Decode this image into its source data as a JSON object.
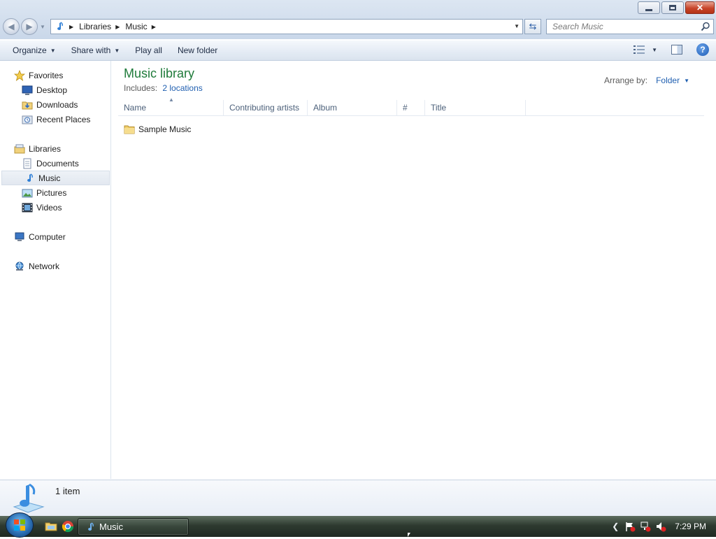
{
  "window": {
    "caption_buttons": {
      "minimize_icon": "minimize-icon",
      "maximize_icon": "restore-icon",
      "close_icon": "close-icon"
    }
  },
  "address": {
    "breadcrumbs": [
      "Libraries",
      "Music"
    ],
    "search_placeholder": "Search Music"
  },
  "toolbar": {
    "organize": "Organize",
    "share_with": "Share with",
    "play_all": "Play all",
    "new_folder": "New folder"
  },
  "navpane": {
    "favorites": {
      "label": "Favorites",
      "items": [
        "Desktop",
        "Downloads",
        "Recent Places"
      ]
    },
    "libraries": {
      "label": "Libraries",
      "items": [
        "Documents",
        "Music",
        "Pictures",
        "Videos"
      ]
    },
    "computer": "Computer",
    "network": "Network",
    "selected": "Music"
  },
  "content": {
    "title": "Music library",
    "includes_label": "Includes:",
    "includes_link": "2 locations",
    "arrange_label": "Arrange by:",
    "arrange_value": "Folder",
    "columns": [
      "Name",
      "Contributing artists",
      "Album",
      "#",
      "Title"
    ],
    "files": [
      {
        "name": "Sample Music",
        "type": "folder"
      }
    ]
  },
  "details": {
    "count": "1 item"
  },
  "taskbar": {
    "active_window": "Music",
    "clock": "7:29 PM"
  },
  "colors": {
    "library_title": "#1f7b3a",
    "link": "#1f5fb0",
    "taskbar": "#2e3a30"
  }
}
